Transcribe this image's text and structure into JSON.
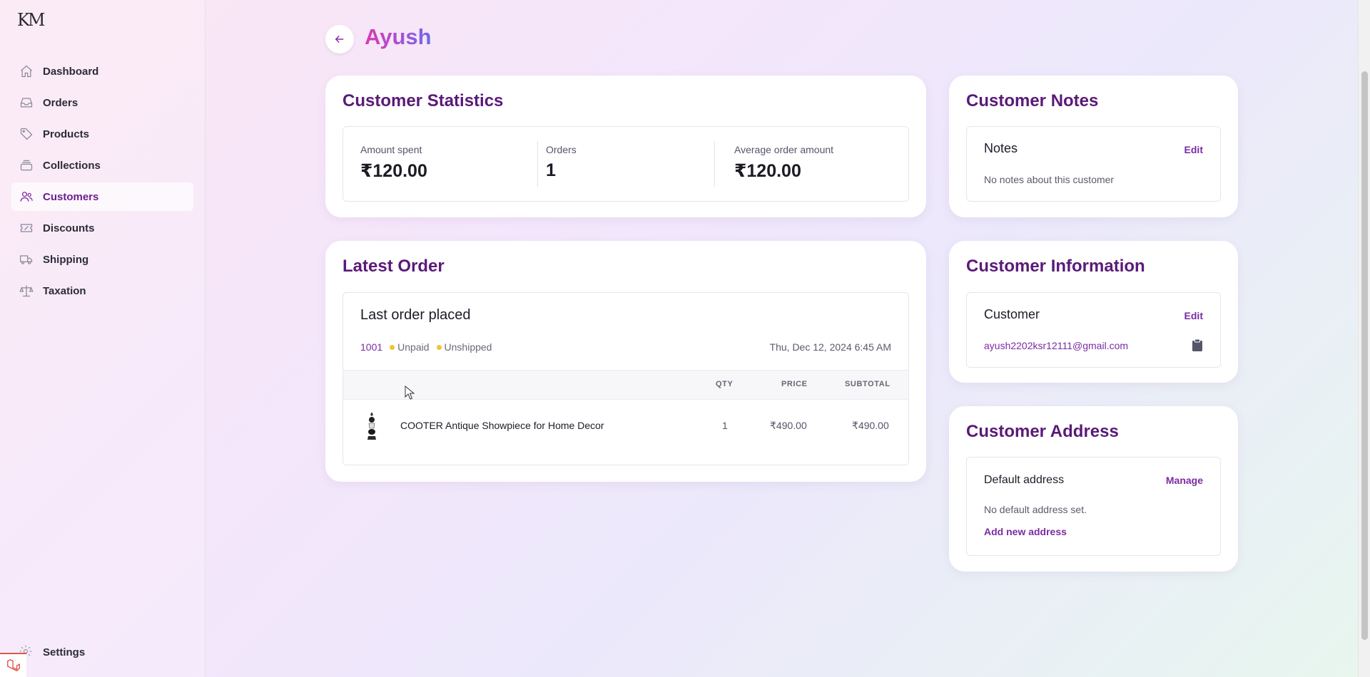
{
  "sidebar": {
    "logo_text": "KM",
    "items": [
      {
        "label": "Dashboard",
        "icon": "home-icon"
      },
      {
        "label": "Orders",
        "icon": "inbox-icon"
      },
      {
        "label": "Products",
        "icon": "tag-icon"
      },
      {
        "label": "Collections",
        "icon": "collection-icon"
      },
      {
        "label": "Customers",
        "icon": "users-icon",
        "active": true
      },
      {
        "label": "Discounts",
        "icon": "ticket-icon"
      },
      {
        "label": "Shipping",
        "icon": "truck-icon"
      },
      {
        "label": "Taxation",
        "icon": "scale-icon"
      }
    ],
    "settings_label": "Settings"
  },
  "header": {
    "title": "Ayush"
  },
  "stats": {
    "title": "Customer Statistics",
    "amount_spent_label": "Amount spent",
    "amount_spent_value": "₹120.00",
    "orders_label": "Orders",
    "orders_value": "1",
    "avg_label": "Average order amount",
    "avg_value": "₹120.00"
  },
  "latest_order": {
    "title": "Latest Order",
    "box_title": "Last order placed",
    "order_number": "1001",
    "payment_status": "Unpaid",
    "shipping_status": "Unshipped",
    "date": "Thu, Dec 12, 2024 6:45 AM",
    "columns": {
      "qty": "QTY",
      "price": "PRICE",
      "subtotal": "SUBTOTAL"
    },
    "items": [
      {
        "name": "COOTER Antique Showpiece for Home Decor",
        "qty": "1",
        "price": "₹490.00",
        "subtotal": "₹490.00"
      }
    ]
  },
  "notes": {
    "title": "Customer Notes",
    "box_title": "Notes",
    "edit_label": "Edit",
    "empty_text": "No notes about this customer"
  },
  "info": {
    "title": "Customer Information",
    "box_title": "Customer",
    "edit_label": "Edit",
    "email": "ayush2202ksr12111@gmail.com"
  },
  "address": {
    "title": "Customer Address",
    "box_title": "Default address",
    "manage_label": "Manage",
    "empty_text": "No default address set.",
    "add_label": "Add new address"
  },
  "colors": {
    "accent": "#7b2ba3",
    "heading": "#5a1a78",
    "status_dot": "#f2c230"
  }
}
